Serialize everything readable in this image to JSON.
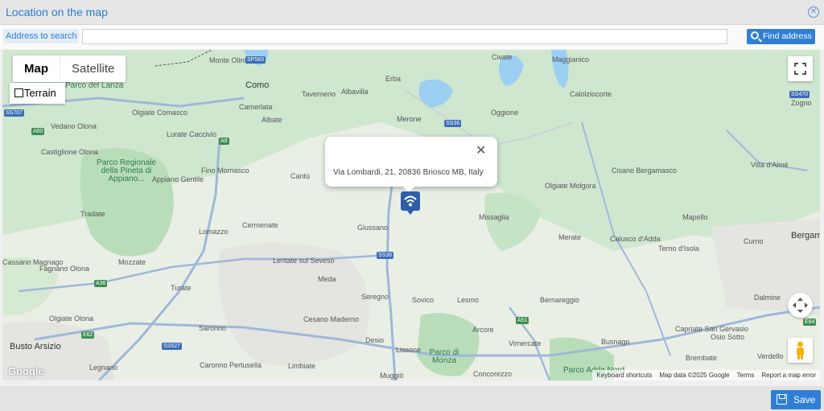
{
  "dialog": {
    "title": "Location on the map"
  },
  "search": {
    "label": "Address to search",
    "value": "",
    "placeholder": "",
    "button_label": "Find address"
  },
  "map": {
    "type_control": {
      "map_label": "Map",
      "satellite_label": "Satellite",
      "terrain_label": "Terrain",
      "selected": "Map"
    },
    "popup": {
      "address": "Via Lombardi, 21, 20836 Briosco MB, Italy"
    },
    "logo": "Google",
    "attribution": {
      "shortcuts": "Keyboard shortcuts",
      "data": "Map data ©2025 Google",
      "terms": "Terms",
      "report": "Report a map error"
    },
    "places": [
      "Como",
      "Erba",
      "Civate",
      "Maggianico",
      "Albavilla",
      "Tavernerio",
      "Calolziocorte",
      "Oggione",
      "Merone",
      "Albate",
      "Camerlata",
      "Olgiate Comasco",
      "Lurate Caccivio",
      "Vedano Olona",
      "Castiglione Olona",
      "Fino Mornasco",
      "Cantù",
      "Appiano Gentile",
      "Tradate",
      "Lomazzo",
      "Cermenate",
      "Giussano",
      "Missaglia",
      "Olgiate Molgora",
      "Cisano Bergamasco",
      "Merate",
      "Calusco d'Adda",
      "Terno d'Isola",
      "Mapello",
      "Villa d'Almè",
      "Curno",
      "Mozzate",
      "Lentate sul Seveso",
      "Meda",
      "Turate",
      "Cassano Magnago",
      "Fagnano Olona",
      "Seregno",
      "Sovico",
      "Lesmo",
      "Bernareggio",
      "Capriate San Gervasio",
      "Osio Sotto",
      "Dalmine",
      "Saronno",
      "Cesano Maderno",
      "Desio",
      "Lissone",
      "Arcore",
      "Vimercate",
      "Busnago",
      "Brembate",
      "Verdello",
      "Busto Arsizio",
      "Olgiate Olona",
      "Legnano",
      "Caronno Pertusella",
      "Limbiate",
      "Muggiò",
      "Concorezzo",
      "Zogno",
      "Bergamo",
      "Monte Olimpino",
      "Villa d'Almè"
    ],
    "parks": [
      "Parco Regionale della Pineta di Appiano...",
      "Parco di Monza",
      "Parco Adda Nord",
      "Parco del Lanza"
    ],
    "roads": [
      "SP583",
      "SS36",
      "SS470",
      "SS707",
      "A60",
      "A9",
      "A36",
      "A51",
      "E62",
      "SS527",
      "E64",
      "SS36"
    ]
  },
  "footer": {
    "save_label": "Save"
  },
  "colors": {
    "accent": "#2f7fd6",
    "title": "#2a7fd4",
    "marker": "#2f5ea8"
  },
  "icons": {
    "close": "close-circle-icon",
    "search": "search-icon",
    "save": "floppy-disk-icon",
    "marker": "wifi-marker-icon"
  }
}
